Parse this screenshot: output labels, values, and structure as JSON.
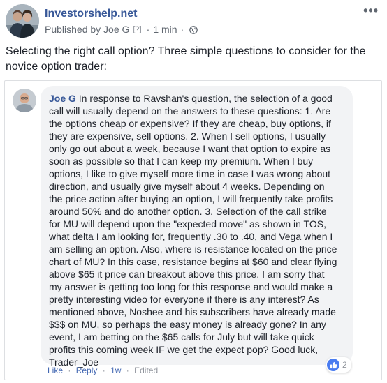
{
  "post": {
    "page_name": "Investorshelp.net",
    "published_by": "Published by Joe G",
    "help_marker": "[?]",
    "separator": "·",
    "time": "1 min",
    "visibility_icon": "globe-icon",
    "more_icon": "more-options-icon",
    "text": "Selecting the right call option? Three simple questions to consider for the novice option trader:"
  },
  "comment": {
    "author": "Joe G",
    "lines": [
      " In response to Ravshan's question, the selection of a good",
      "call will usually depend on the answers to these questions: 1. Are",
      "the options cheap or expensive? If they are cheap, buy options, if",
      "they are expensive, sell options. 2. When I sell options, I usually",
      "only go out about a week, because I want that option to expire as",
      "soon as possible so that I can keep my premium. When I buy",
      "options, I like to give myself more time in case I was wrong about",
      "direction, and usually give myself about 4 weeks. Depending on",
      "the price action after buying an option, I will frequently take profits",
      "around 50% and do another option. 3. Selection of the call strike",
      "for MU will depend upon the \"expected move\" as shown in TOS,",
      "what delta I am looking for, frequently .30 to .40, and Vega when I",
      "am selling an option. Also, where is resistance located on the price",
      "chart of MU? In this case, resistance begins at $60 and clear flying",
      "above $65 it price can breakout above this price. I am sorry that",
      "my answer is getting too long for this response and would make a",
      "pretty interesting video for everyone if there is any interest? As",
      "mentioned above, Noshee and his subscribers have already made",
      "$$$ on MU, so perhaps the easy money is already gone? In any",
      "event, I am betting on the $65 calls for July but will take quick",
      "profits this coming week IF we get the expect pop? Good luck,",
      "Trader_Joe"
    ],
    "actions": {
      "like": "Like",
      "reply": "Reply",
      "age": "1w",
      "edited": "Edited",
      "separator": "·"
    },
    "reactions": {
      "icon": "like-thumb-icon",
      "count": "2"
    }
  },
  "colors": {
    "link_blue": "#385898",
    "action_blue": "#4267b2",
    "meta_gray": "#606770",
    "bubble_bg": "#f2f3f5",
    "like_blue": "#4a7cf0"
  }
}
